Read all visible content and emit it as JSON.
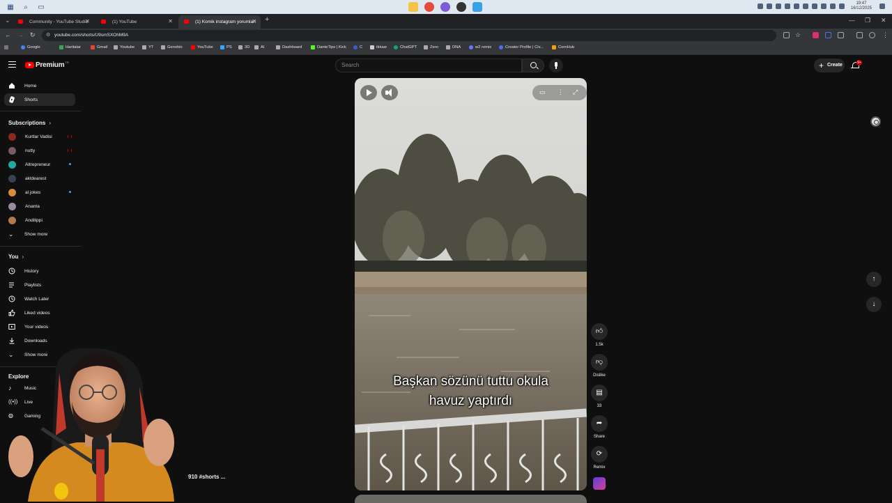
{
  "os": {
    "clock_time": "19:47",
    "clock_date": "16/12/2025"
  },
  "browser": {
    "tabs": [
      {
        "label": "Community - YouTube Studio"
      },
      {
        "label": "(1) YouTube"
      },
      {
        "label": "(1) Komik instagram yorumları"
      }
    ],
    "url": "youtube.com/shorts/U9smSXOhM9A",
    "bookmarks": [
      {
        "label": "Google",
        "color": "#4285f4"
      },
      {
        "label": "Haritalar",
        "color": "#34a853"
      },
      {
        "label": "Gmail",
        "color": "#ea4335"
      },
      {
        "label": "Youtube",
        "color": "#aaaaaa"
      },
      {
        "label": "YT",
        "color": "#aaaaaa"
      },
      {
        "label": "Genshin",
        "color": "#aaaaaa"
      },
      {
        "label": "YouTube",
        "color": "#ff0000"
      },
      {
        "label": "PS",
        "color": "#31a8ff"
      },
      {
        "label": "3D",
        "color": "#aaaaaa"
      },
      {
        "label": "AI",
        "color": "#aaaaaa"
      },
      {
        "label": "Dashboard",
        "color": "#aaaaaa"
      },
      {
        "label": "DanteTips | Kick",
        "color": "#53fc18"
      },
      {
        "label": "C",
        "color": "#3b5bdb"
      },
      {
        "label": "tlıkaw",
        "color": "#cccccc"
      },
      {
        "label": "ChatGPT",
        "color": "#10a37f"
      },
      {
        "label": "Zero",
        "color": "#aaaaaa"
      },
      {
        "label": "DNA",
        "color": "#aaaaaa"
      },
      {
        "label": "w2 remix",
        "color": "#5c7cfa"
      },
      {
        "label": "Creator Profile | Civ...",
        "color": "#4c6ef5"
      },
      {
        "label": "CornHub",
        "color": "#f59f00"
      }
    ]
  },
  "youtube": {
    "logo_text": "Premium",
    "logo_sup": "TR",
    "search_placeholder": "Search",
    "create_label": "Create",
    "notification_count": "9+",
    "sidebar": {
      "main": [
        {
          "label": "Home"
        },
        {
          "label": "Shorts"
        }
      ],
      "subscriptions_title": "Subscriptions",
      "subscriptions": [
        {
          "label": "Kurtlar Vadisi",
          "color": "#8a2a1e",
          "indicator": "live"
        },
        {
          "label": "nutty",
          "color": "#7a5a6a",
          "indicator": "live"
        },
        {
          "label": "Altrepreneur",
          "color": "#1fa9a0",
          "indicator": "dot"
        },
        {
          "label": "akldearest",
          "color": "#3a3f55",
          "indicator": "none"
        },
        {
          "label": "al jokes",
          "color": "#d98a3a",
          "indicator": "dot"
        },
        {
          "label": "Ananta",
          "color": "#9a8aa0",
          "indicator": "none"
        },
        {
          "label": "Andilippi",
          "color": "#b07a4a",
          "indicator": "none"
        }
      ],
      "show_more": "Show more",
      "you_title": "You",
      "you": [
        {
          "label": "History"
        },
        {
          "label": "Playlists"
        },
        {
          "label": "Watch Later"
        },
        {
          "label": "Liked videos"
        },
        {
          "label": "Your videos"
        },
        {
          "label": "Downloads"
        }
      ],
      "you_show_more": "Show more",
      "explore_title": "Explore",
      "explore": [
        {
          "label": "Music"
        },
        {
          "label": "Live"
        },
        {
          "label": "Gaming"
        }
      ]
    },
    "short": {
      "caption_line1": "Başkan sözünü tuttu okula",
      "caption_line2": "havuz yaptırdı",
      "likes": "1.5k",
      "dislike_label": "Dislike",
      "comments": "33",
      "share_label": "Share",
      "remix_label": "Remix"
    },
    "background_partial_text": "910 #shorts ..."
  }
}
